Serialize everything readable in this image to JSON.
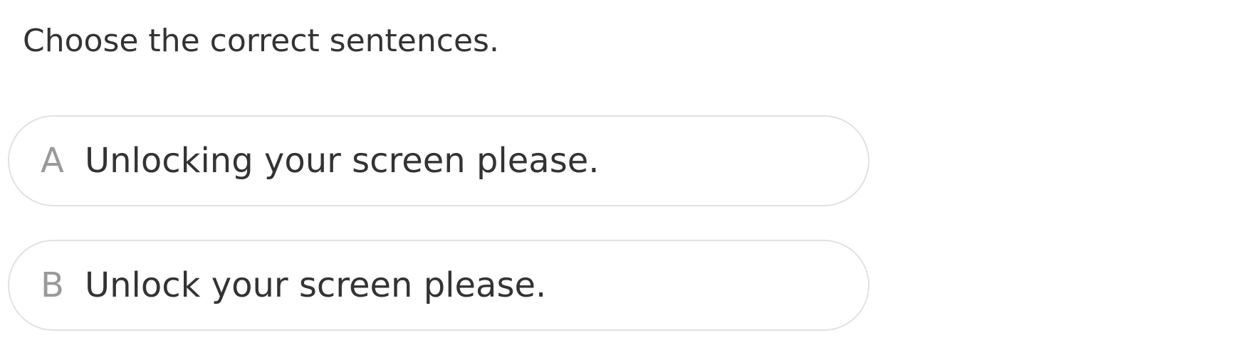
{
  "question": {
    "prompt": "Choose the correct sentences."
  },
  "options": [
    {
      "letter": "A",
      "text": "Unlocking your screen please."
    },
    {
      "letter": "B",
      "text": "Unlock your screen please."
    }
  ],
  "colors": {
    "text": "#333333",
    "letter": "#9a9a9a",
    "border": "#e1e1e1",
    "background": "#ffffff"
  }
}
